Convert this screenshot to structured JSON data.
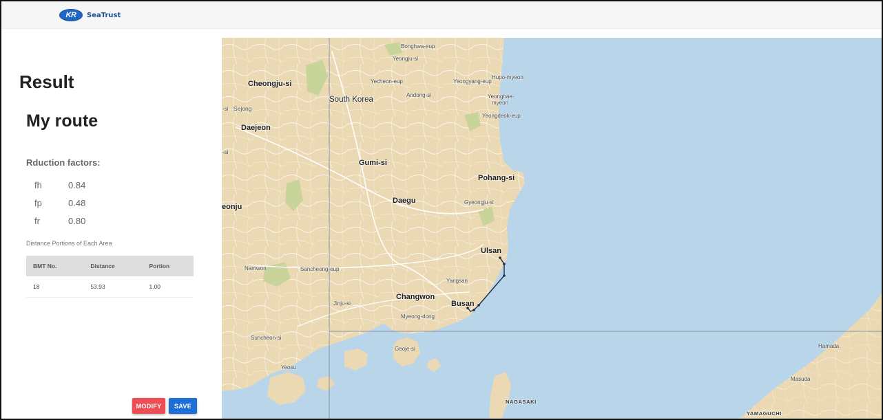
{
  "header": {
    "logo_badge": "KR",
    "app_name": "SeaTrust"
  },
  "panel": {
    "result_title": "Result",
    "route_title": "My route",
    "reduction_heading": "Rduction factors:",
    "factors": [
      {
        "key": "fh",
        "value": "0.84"
      },
      {
        "key": "fp",
        "value": "0.48"
      },
      {
        "key": "fr",
        "value": "0.80"
      }
    ],
    "distance_caption": "Distance Portions of Each Area",
    "table": {
      "headers": [
        "BMT No.",
        "Distance",
        "Portion"
      ],
      "rows": [
        [
          "18",
          "53.93",
          "1.00"
        ]
      ]
    },
    "buttons": {
      "modify": "MODIFY",
      "save": "SAVE"
    }
  },
  "map": {
    "colors": {
      "land": "#ead9b3",
      "sea": "#b8d5ea",
      "route": "#1e2a4a",
      "grid": "#8a8e9e"
    },
    "labels": {
      "south_korea": "South Korea",
      "cheongju": "Cheongju-si",
      "sejong": "Sejong",
      "daejeon": "Daejeon",
      "gumi": "Gumi-si",
      "daegu": "Daegu",
      "pohang": "Pohang-si",
      "gyeongju": "Gyeongju-si",
      "ulsan": "Ulsan",
      "yangsan": "Yangsan",
      "changwon": "Changwon",
      "busan": "Busan",
      "myeongdong": "Myeong-dong",
      "jinju": "Jinju-si",
      "namwon": "Namwon",
      "sancheong": "Sancheong-eup",
      "suncheon": "Suncheon-si",
      "yeosu": "Yeosu",
      "geoje": "Geoje-si",
      "bonghwa": "Bonghwa-eup",
      "yeongju": "Yeongju-si",
      "yecheon": "Yecheon-eup",
      "andong": "Andong-si",
      "yeongyang": "Yeongyang-eup",
      "hupo": "Hupo-myeon",
      "yeonghae_1": "Yeonghae-",
      "yeonghae_2": "myeon",
      "yeongdeok": "Yeongdeok-eup",
      "hamada": "Hamada",
      "masuda": "Masuda",
      "nagasaki": "NAGASAKI",
      "yamaguchi": "YAMAGUCHI",
      "edge_si_1": "-si",
      "edge_si_2": "-si",
      "edge_jeonju": "eonju"
    }
  }
}
